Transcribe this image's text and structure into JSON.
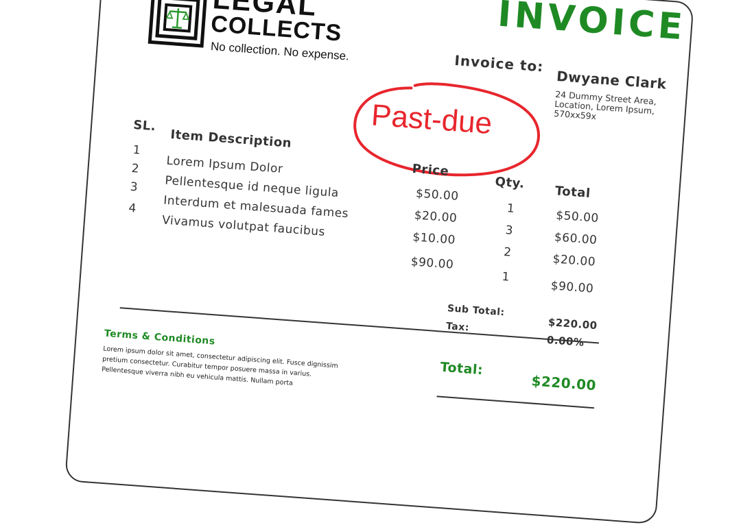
{
  "logo": {
    "line1": "LEGAL",
    "line2": "COLLECTS",
    "tagline": "No collection. No expense."
  },
  "header": {
    "title": "INVOICE",
    "invoice_to_label": "Invoice to:",
    "customer_name": "Dwyane Clark",
    "address": "24 Dummy Street Area, Location, Lorem Ipsum, 570xx59x"
  },
  "stamp": {
    "text": "Past-due",
    "color": "#e8262d"
  },
  "table": {
    "headers": {
      "sl": "SL.",
      "description": "Item Description",
      "price": "Price",
      "qty": "Qty.",
      "total": "Total"
    },
    "rows": [
      {
        "sl": "1",
        "description": "Lorem Ipsum Dolor",
        "price": "$50.00",
        "qty": "1",
        "total": "$50.00"
      },
      {
        "sl": "2",
        "description": "Pellentesque id neque ligula",
        "price": "$20.00",
        "qty": "3",
        "total": "$60.00"
      },
      {
        "sl": "3",
        "description": "Interdum et malesuada fames",
        "price": "$10.00",
        "qty": "2",
        "total": "$20.00"
      },
      {
        "sl": "4",
        "description": "Vivamus volutpat faucibus",
        "price": "$90.00",
        "qty": "1",
        "total": "$90.00"
      }
    ]
  },
  "summary": {
    "subtotal_label": "Sub Total:",
    "subtotal_value": "$220.00",
    "tax_label": "Tax:",
    "tax_value": "0.00%",
    "total_label": "Total:",
    "total_value": "$220.00"
  },
  "terms": {
    "title": "Terms & Conditions",
    "body": "Lorem ipsum dolor sit amet, consectetur adipiscing elit. Fusce dignissim pretium consectetur. Curabitur tempor posuere massa in varius. Pellentesque viverra nibh eu vehicula mattis. Nullam porta"
  },
  "colors": {
    "brand_green": "#1f8a24",
    "stamp_red": "#e8262d",
    "text": "#333333"
  }
}
